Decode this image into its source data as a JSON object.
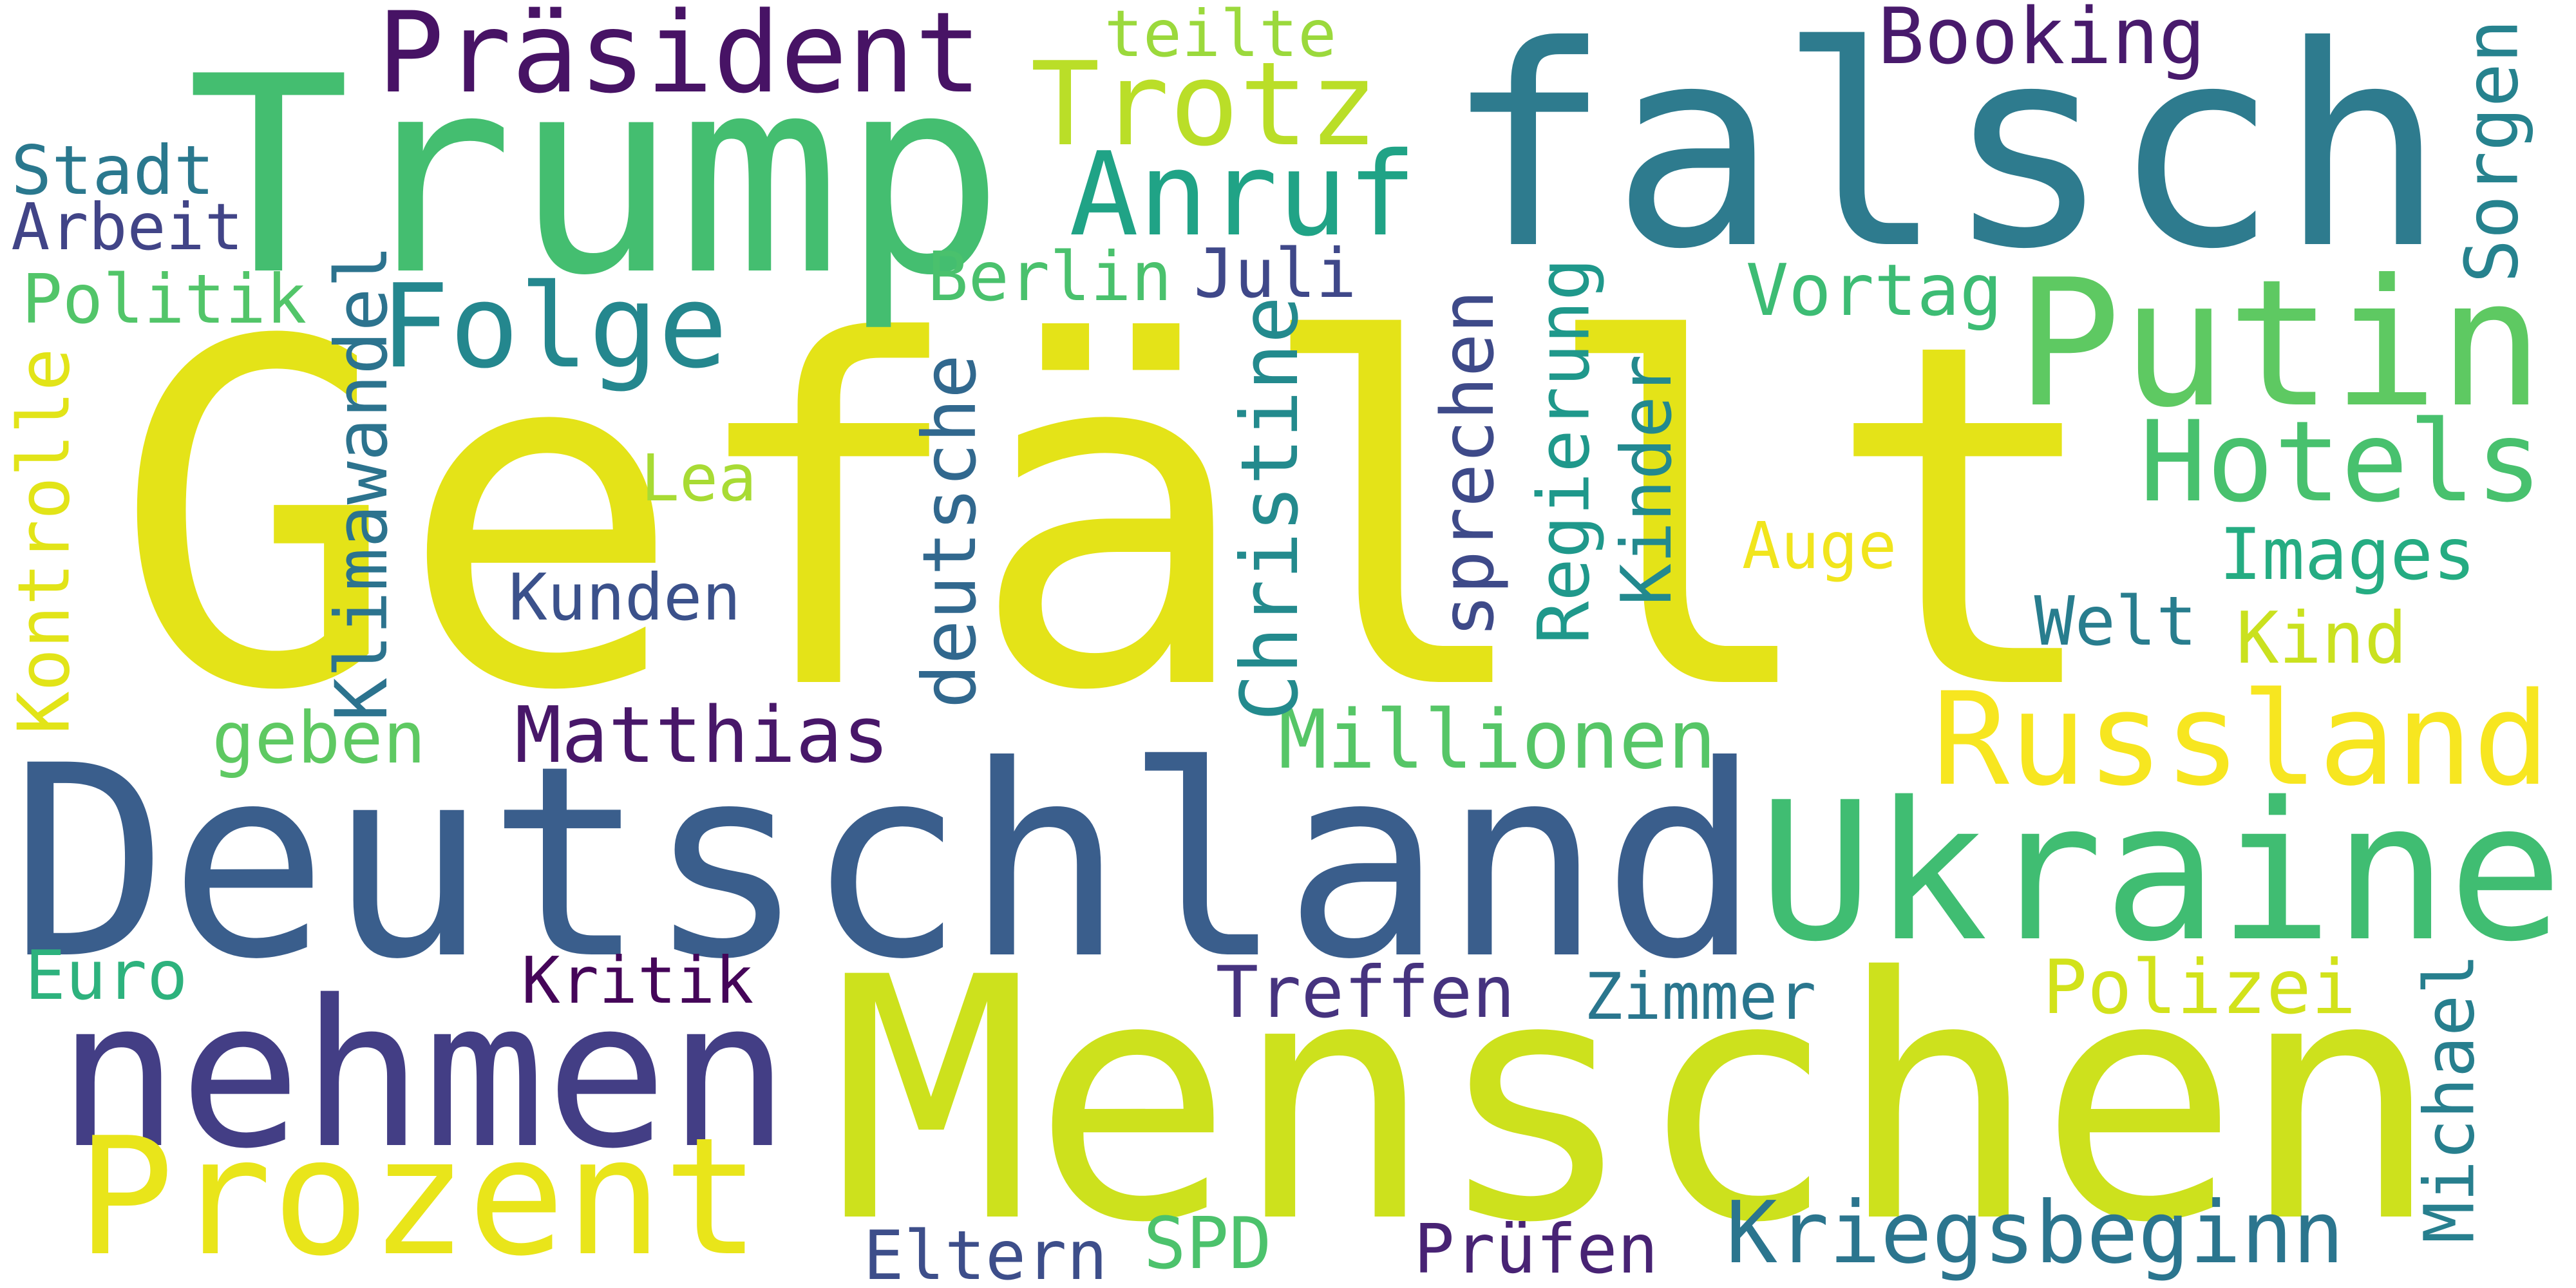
{
  "word_cloud": {
    "background": "#ffffff",
    "words": [
      {
        "text": "Gefällt",
        "color": "#e4e318",
        "orientation": "horizontal"
      },
      {
        "text": "Deutschland",
        "color": "#3a5e8c",
        "orientation": "horizontal"
      },
      {
        "text": "Menschen",
        "color": "#cde11d",
        "orientation": "horizontal"
      },
      {
        "text": "falsch",
        "color": "#2e7b8e",
        "orientation": "horizontal"
      },
      {
        "text": "Trump",
        "color": "#44be70",
        "orientation": "horizontal"
      },
      {
        "text": "nehmen",
        "color": "#433e85",
        "orientation": "horizontal"
      },
      {
        "text": "Ukraine",
        "color": "#40bd72",
        "orientation": "horizontal"
      },
      {
        "text": "Prozent",
        "color": "#e9e51a",
        "orientation": "horizontal"
      },
      {
        "text": "Putin",
        "color": "#5ec962",
        "orientation": "horizontal"
      },
      {
        "text": "Russland",
        "color": "#f7e620",
        "orientation": "horizontal"
      },
      {
        "text": "Präsident",
        "color": "#471365",
        "orientation": "horizontal"
      },
      {
        "text": "Hotels",
        "color": "#48c16e",
        "orientation": "horizontal"
      },
      {
        "text": "Trotz",
        "color": "#bade28",
        "orientation": "horizontal"
      },
      {
        "text": "Anruf",
        "color": "#20a386",
        "orientation": "horizontal"
      },
      {
        "text": "Folge",
        "color": "#24878e",
        "orientation": "horizontal"
      },
      {
        "text": "Kriegsbeginn",
        "color": "#2b758e",
        "orientation": "horizontal"
      },
      {
        "text": "Matthias",
        "color": "#481769",
        "orientation": "horizontal"
      },
      {
        "text": "Millionen",
        "color": "#56c667",
        "orientation": "horizontal"
      },
      {
        "text": "Booking",
        "color": "#481a6c",
        "orientation": "horizontal"
      },
      {
        "text": "Images",
        "color": "#25ac82",
        "orientation": "horizontal"
      },
      {
        "text": "Polizei",
        "color": "#d2e21b",
        "orientation": "horizontal"
      },
      {
        "text": "Treffen",
        "color": "#46337f",
        "orientation": "horizontal"
      },
      {
        "text": "Zimmer",
        "color": "#2a768e",
        "orientation": "horizontal"
      },
      {
        "text": "Kritik",
        "color": "#450559",
        "orientation": "horizontal"
      },
      {
        "text": "Kunden",
        "color": "#3b518b",
        "orientation": "horizontal"
      },
      {
        "text": "geben",
        "color": "#5ec962",
        "orientation": "horizontal"
      },
      {
        "text": "Eltern",
        "color": "#3d4e8a",
        "orientation": "horizontal"
      },
      {
        "text": "SPD",
        "color": "#4cc26c",
        "orientation": "horizontal"
      },
      {
        "text": "Prüfen",
        "color": "#482374",
        "orientation": "horizontal"
      },
      {
        "text": "Euro",
        "color": "#2db27d",
        "orientation": "horizontal"
      },
      {
        "text": "Kind",
        "color": "#cae11f",
        "orientation": "horizontal"
      },
      {
        "text": "Welt",
        "color": "#287d8e",
        "orientation": "horizontal"
      },
      {
        "text": "Auge",
        "color": "#f1e51d",
        "orientation": "horizontal"
      },
      {
        "text": "Lea",
        "color": "#a8db34",
        "orientation": "horizontal"
      },
      {
        "text": "Vortag",
        "color": "#3dbc74",
        "orientation": "horizontal"
      },
      {
        "text": "Berlin",
        "color": "#4ac16d",
        "orientation": "horizontal"
      },
      {
        "text": "Juli",
        "color": "#3f4889",
        "orientation": "horizontal"
      },
      {
        "text": "teilte",
        "color": "#9bd93c",
        "orientation": "horizontal"
      },
      {
        "text": "Stadt",
        "color": "#2a788e",
        "orientation": "horizontal"
      },
      {
        "text": "Arbeit",
        "color": "#414487",
        "orientation": "horizontal"
      },
      {
        "text": "Politik",
        "color": "#52c569",
        "orientation": "horizontal"
      },
      {
        "text": "Kontrolle",
        "color": "#e2e418",
        "orientation": "vertical"
      },
      {
        "text": "Klimawandel",
        "color": "#2c738e",
        "orientation": "vertical"
      },
      {
        "text": "deutsche",
        "color": "#31688e",
        "orientation": "vertical"
      },
      {
        "text": "Christine",
        "color": "#238a8d",
        "orientation": "vertical"
      },
      {
        "text": "sprechen",
        "color": "#3e4a89",
        "orientation": "vertical"
      },
      {
        "text": "Regierung",
        "color": "#1f988b",
        "orientation": "vertical"
      },
      {
        "text": "Kinder",
        "color": "#23898e",
        "orientation": "vertical"
      },
      {
        "text": "Sorgen",
        "color": "#26828e",
        "orientation": "vertical"
      },
      {
        "text": "Michael",
        "color": "#277f8e",
        "orientation": "vertical"
      }
    ]
  }
}
